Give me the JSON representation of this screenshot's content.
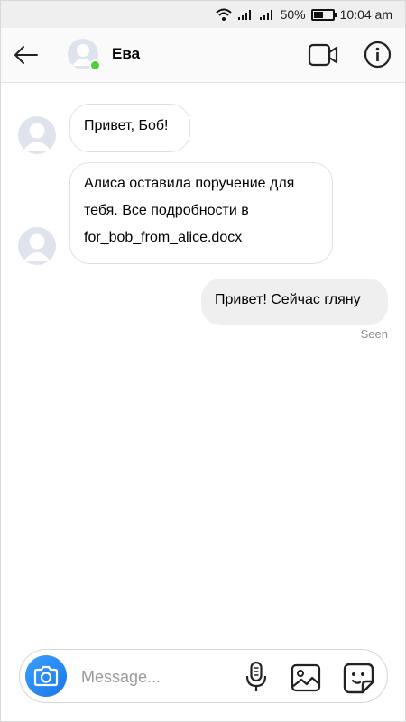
{
  "status_bar": {
    "battery": "50%",
    "time": "10:04 am",
    "icons": [
      "wifi-icon",
      "signal-icon",
      "signal-icon",
      "battery-icon"
    ]
  },
  "header": {
    "contact_name": "Ева",
    "online": true,
    "icons": [
      "back-arrow-icon",
      "avatar",
      "video-camera-icon",
      "info-icon"
    ]
  },
  "messages": [
    {
      "direction": "incoming",
      "lines": [
        "Привет, Боб!"
      ]
    },
    {
      "direction": "incoming",
      "lines": [
        "Алиса оставила поручение для",
        "тебя. Все подробности в",
        "for_bob_from_alice.docx"
      ]
    },
    {
      "direction": "outgoing",
      "lines": [
        "Привет! Сейчас гляну"
      ]
    }
  ],
  "seen_label": "Seen",
  "composer": {
    "placeholder": "Message...",
    "icons": [
      "camera-icon",
      "microphone-icon",
      "gallery-icon",
      "sticker-icon"
    ]
  },
  "colors": {
    "online_dot": "#4cd137",
    "camera_button": "#1877e8",
    "outgoing_bubble": "#efefef",
    "seen_text": "#8e8e8e"
  }
}
